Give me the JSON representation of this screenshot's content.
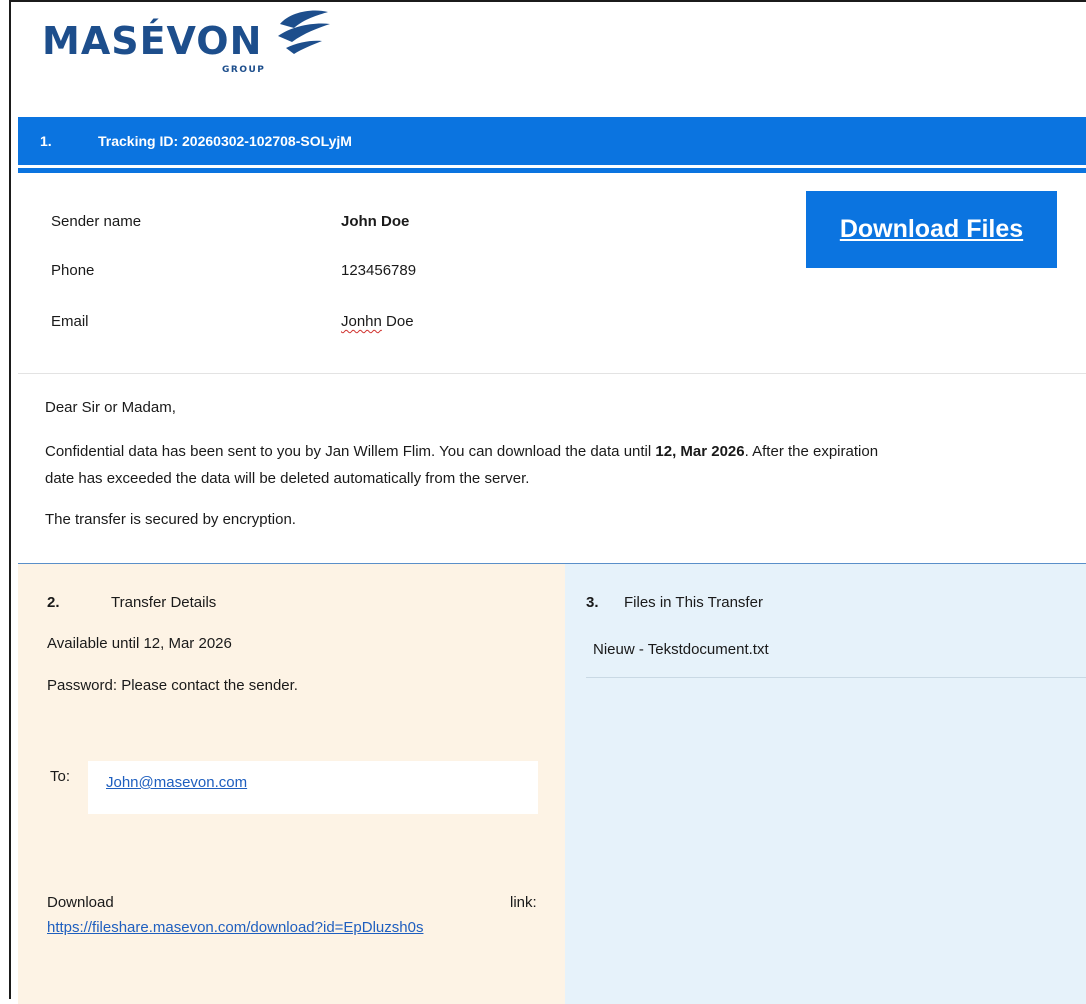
{
  "brand": {
    "name": "MASÉVON",
    "sub": "GROUP",
    "color": "#1d4e8c"
  },
  "tracking": {
    "number": "1.",
    "label": "Tracking ID: 20260302-102708-SOLyjM"
  },
  "sender": {
    "name_label": "Sender name",
    "name_value": "John Doe",
    "phone_label": "Phone",
    "phone_value": "123456789",
    "email_label": "Email",
    "email_value_misspelled": "Jonhn",
    "email_value_rest": " Doe"
  },
  "download_button": {
    "label": "Download Files"
  },
  "message": {
    "greeting": "Dear Sir or Madam,",
    "line1_pre": "Confidential data has been sent to you by Jan Willem Flim. You can download the data until ",
    "line1_date": "12, Mar 2026",
    "line1_post": ". After the expiration",
    "line2": "date has exceeded the data will be deleted automatically from the server.",
    "line3": "The transfer is secured by encryption."
  },
  "transfer_details": {
    "number": "2.",
    "title": "Transfer Details",
    "available": "Available until 12, Mar 2026",
    "password": "Password: Please contact the sender.",
    "to_label": "To:",
    "to_email": "John@masevon.com",
    "download_label": "Download",
    "link_label": "link:",
    "download_url": "https://fileshare.masevon.com/download?id=EpDluzsh0s"
  },
  "files": {
    "number": "3.",
    "title": "Files in This Transfer",
    "items": [
      "Nieuw - Tekstdocument.txt"
    ]
  },
  "colors": {
    "accent_blue": "#0b74e0",
    "left_panel": "#fdf3e5",
    "right_panel": "#e6f2fa",
    "link": "#1f5fbf"
  }
}
